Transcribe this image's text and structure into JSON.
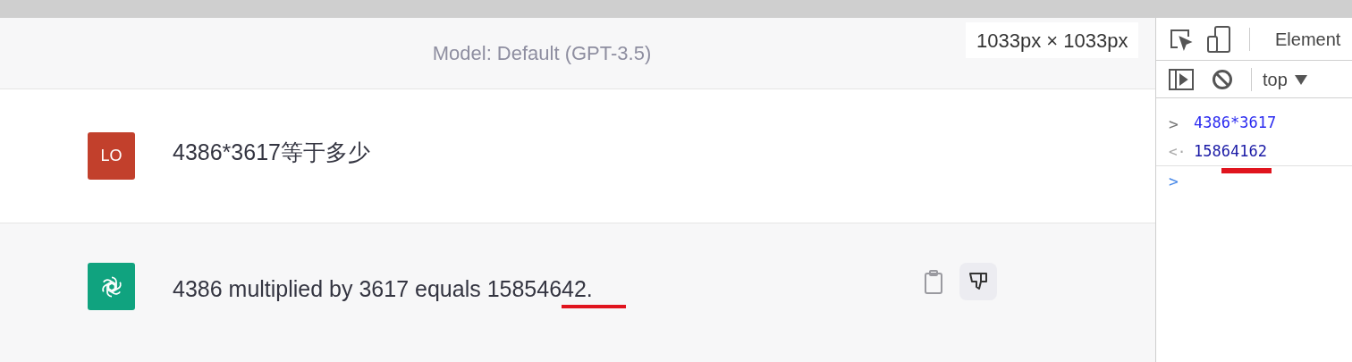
{
  "chat": {
    "model_label": "Model: Default (GPT-3.5)",
    "size_badge": "1033px × 1033px",
    "messages": [
      {
        "kind": "user",
        "avatar": "LO",
        "text": "4386*3617等于多少"
      },
      {
        "kind": "assistant",
        "text": "4386 multiplied by 3617 equals 15854642."
      }
    ]
  },
  "devtools": {
    "tab": "Element",
    "context": "top",
    "console": [
      {
        "kind": "input",
        "prompt": ">",
        "text": "4386*3617"
      },
      {
        "kind": "output",
        "prompt": "<·",
        "text": "15864162"
      },
      {
        "kind": "prompt",
        "prompt": ">"
      }
    ]
  }
}
